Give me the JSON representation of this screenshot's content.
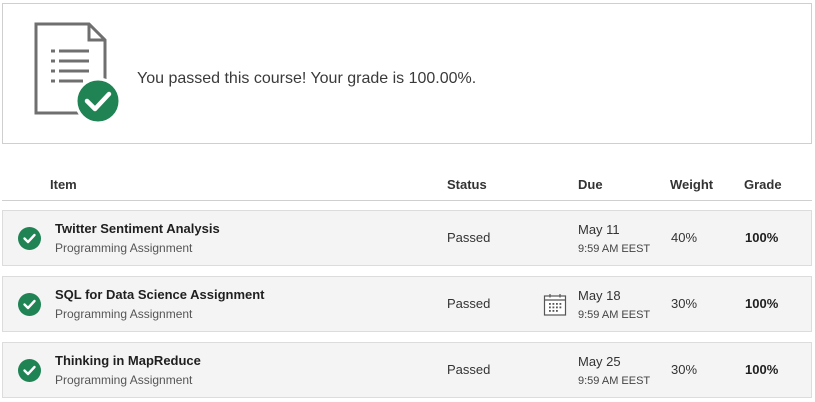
{
  "banner": {
    "message": "You passed this course! Your grade is 100.00%.",
    "icon": "document-with-check-icon"
  },
  "table": {
    "headers": {
      "item": "Item",
      "status": "Status",
      "due": "Due",
      "weight": "Weight",
      "grade": "Grade"
    },
    "rows": [
      {
        "title": "Twitter Sentiment Analysis",
        "type": "Programming Assignment",
        "status": "Passed",
        "due_date": "May 11",
        "due_time": "9:59 AM EEST",
        "weight": "40%",
        "grade": "100%"
      },
      {
        "title": "SQL for Data Science Assignment",
        "type": "Programming Assignment",
        "status": "Passed",
        "due_date": "May 18",
        "due_time": "9:59 AM EEST",
        "weight": "30%",
        "grade": "100%",
        "icon": "calendar-icon"
      },
      {
        "title": "Thinking in MapReduce",
        "type": "Programming Assignment",
        "status": "Passed",
        "due_date": "May 25",
        "due_time": "9:59 AM EEST",
        "weight": "30%",
        "grade": "100%"
      }
    ]
  },
  "colors": {
    "success_green": "#1f8354",
    "row_background": "#f4f4f4",
    "border": "#cfcfcf"
  }
}
